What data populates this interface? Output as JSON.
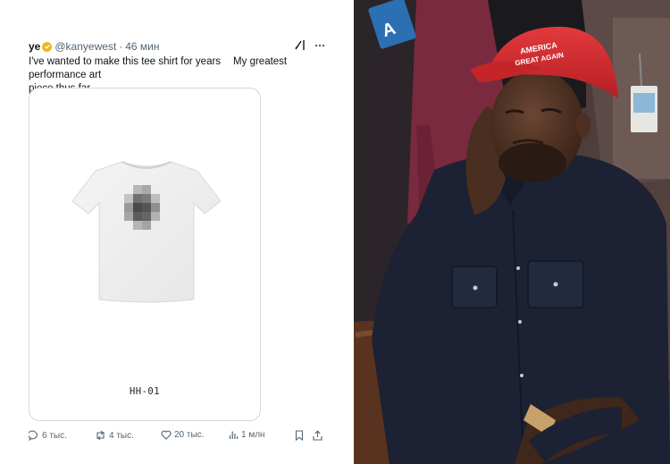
{
  "tweet": {
    "display_name": "ye",
    "handle": "@kanyewest",
    "separator": "·",
    "time": "46 мин",
    "text_part1": "I've wanted to make this tee shirt for years",
    "text_part2": "My greatest performance art",
    "text_part3": "piece thus far",
    "media_label": "HH-01",
    "stats": {
      "replies": "6 тыс.",
      "reposts": "4 тыс.",
      "likes": "20 тыс.",
      "views": "1 млн"
    }
  },
  "photo": {
    "cap_text_line1": "AMERICA",
    "cap_text_line2": "GREAT AGAIN"
  },
  "colors": {
    "verified_badge": "#e8b923",
    "muted_text": "#536471",
    "cap_red": "#d42a2f",
    "shirt_dark": "#1c2233"
  }
}
